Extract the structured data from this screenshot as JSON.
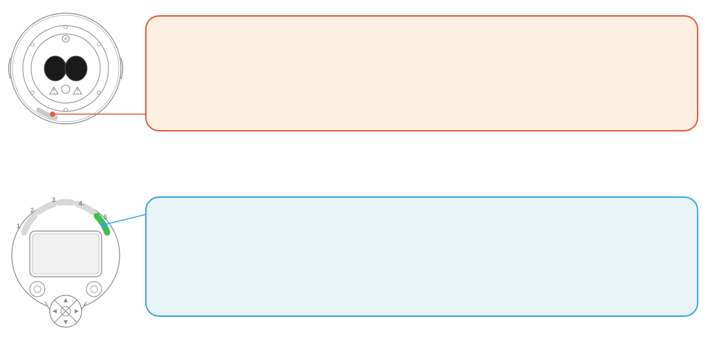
{
  "diagram": {
    "type": "callout-illustration",
    "items": [
      {
        "id": "top",
        "callout_color": "#e2583b",
        "callout_fill": "#fdf0e2",
        "callout_text": "",
        "device": "projector-front-lens",
        "pointer_target": "bottom-front-rim"
      },
      {
        "id": "bottom",
        "callout_color": "#3aa5dc",
        "callout_fill": "#e9f4f8",
        "callout_text": "",
        "device": "controller-face-5-segments",
        "pointer_target": "segment-5",
        "segments": [
          {
            "index": 1,
            "label": "1.",
            "active": false
          },
          {
            "index": 2,
            "label": "2.",
            "active": false
          },
          {
            "index": 3,
            "label": "3.",
            "active": false
          },
          {
            "index": 4,
            "label": "4.",
            "active": false
          },
          {
            "index": 5,
            "label": "5.",
            "active": true
          }
        ]
      }
    ]
  }
}
